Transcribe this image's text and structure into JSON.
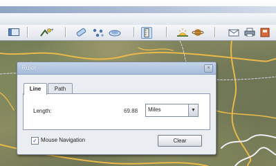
{
  "toolbar": {
    "buttons": [
      {
        "icon": "sidebar-toggle-icon"
      },
      {
        "icon": "add-placemark-icon"
      },
      {
        "icon": "add-path-icon"
      },
      {
        "icon": "add-polygon-icon"
      },
      {
        "icon": "add-overlay-icon"
      },
      {
        "icon": "ruler-icon",
        "pressed": true
      },
      {
        "icon": "sunlight-icon"
      },
      {
        "icon": "planets-icon"
      },
      {
        "icon": "email-icon"
      },
      {
        "icon": "print-icon"
      },
      {
        "icon": "save-image-icon"
      }
    ]
  },
  "dialog": {
    "title": "Ruler",
    "close_glyph": "×",
    "tabs": [
      {
        "label": "Line",
        "active": true
      },
      {
        "label": "Path",
        "active": false
      }
    ],
    "length_label": "Length:",
    "length_value": "69.88",
    "unit": "Miles",
    "mouse_navigation_label": "Mouse Navigation",
    "mouse_navigation_checked": true,
    "clear_label": "Clear"
  },
  "colors": {
    "road": "#e9b94a",
    "border": "#d8d0e6"
  }
}
